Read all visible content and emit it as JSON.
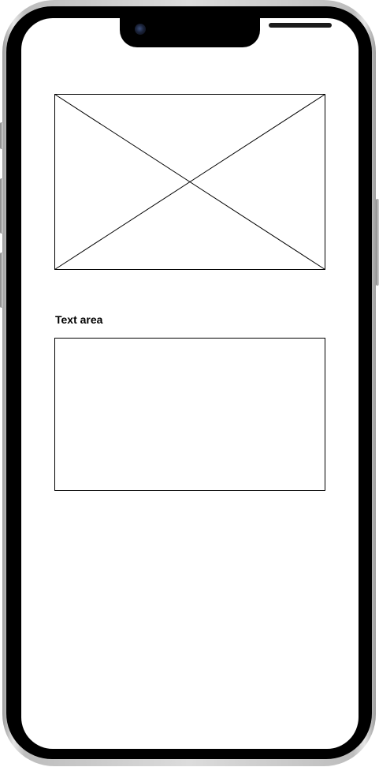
{
  "device": {
    "frame_color": "#d4d4d4",
    "bezel_color": "#000000",
    "screen_color": "#ffffff"
  },
  "content": {
    "image_placeholder": {
      "icon": "image-placeholder-x",
      "stroke_color": "#000000"
    },
    "text_area": {
      "label": "Text area",
      "value": ""
    }
  }
}
